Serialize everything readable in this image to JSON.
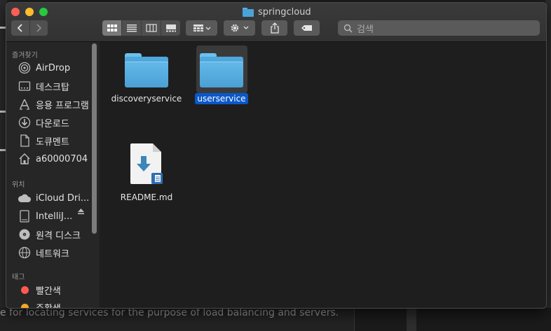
{
  "window": {
    "title": "springcloud",
    "search_placeholder": "검색"
  },
  "sidebar": {
    "favorites_header": "즐겨찾기",
    "favorites": [
      {
        "label": "AirDrop",
        "icon": "airdrop-icon"
      },
      {
        "label": "데스크탑",
        "icon": "desktop-icon"
      },
      {
        "label": "응용 프로그램",
        "icon": "applications-icon"
      },
      {
        "label": "다운로드",
        "icon": "downloads-icon"
      },
      {
        "label": "도큐멘트",
        "icon": "documents-icon"
      },
      {
        "label": "a60000704",
        "icon": "home-icon"
      }
    ],
    "locations_header": "위치",
    "locations": [
      {
        "label": "iCloud Dri...",
        "icon": "icloud-icon"
      },
      {
        "label": "IntelliJ...",
        "icon": "disk-icon"
      },
      {
        "label": "원격 디스크",
        "icon": "remote-disc-icon"
      },
      {
        "label": "네트워크",
        "icon": "network-icon"
      }
    ],
    "tags_header": "태그",
    "tags": [
      {
        "label": "빨간색",
        "color": "#ff5a52"
      },
      {
        "label": "주황색",
        "color": "#f5a623"
      }
    ]
  },
  "files": [
    {
      "name": "discoveryservice",
      "type": "folder",
      "selected": false
    },
    {
      "name": "userservice",
      "type": "folder",
      "selected": true
    },
    {
      "name": "README.md",
      "type": "markdown-document",
      "selected": false
    }
  ],
  "background": {
    "text": "e for locating services for the purpose of load balancing and servers."
  }
}
